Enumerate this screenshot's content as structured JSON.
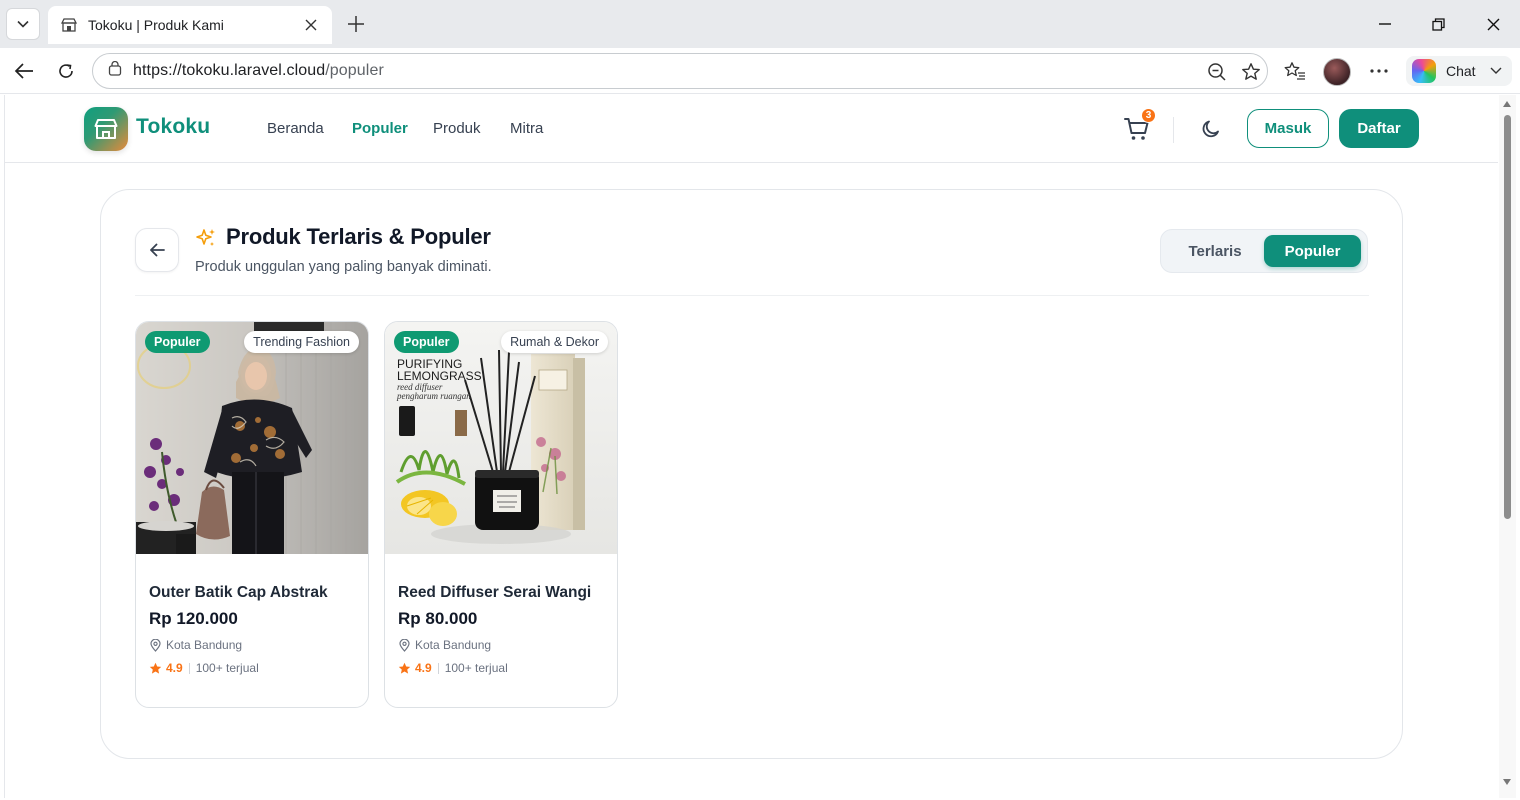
{
  "browser": {
    "tab_title": "Tokoku | Produk Kami",
    "url_host": "https://tokoku.laravel.cloud",
    "url_path": "/populer",
    "chat_label": "Chat"
  },
  "header": {
    "brand": "Tokoku",
    "nav": [
      {
        "label": "Beranda",
        "active": false
      },
      {
        "label": "Populer",
        "active": true
      },
      {
        "label": "Produk",
        "active": false
      },
      {
        "label": "Mitra",
        "active": false
      }
    ],
    "cart_count": "3",
    "login_label": "Masuk",
    "register_label": "Daftar"
  },
  "section": {
    "title": "Produk Terlaris & Populer",
    "subtitle": "Produk unggulan yang paling banyak diminati.",
    "tabs": [
      {
        "label": "Terlaris",
        "selected": false
      },
      {
        "label": "Populer",
        "selected": true
      }
    ]
  },
  "products": [
    {
      "badge": "Populer",
      "category": "Trending Fashion",
      "name": "Outer Batik Cap Abstrak",
      "price": "Rp 120.000",
      "location": "Kota Bandung",
      "rating": "4.9",
      "sold": "100+ terjual"
    },
    {
      "badge": "Populer",
      "category": "Rumah & Dekor",
      "name": "Reed Diffuser Serai Wangi",
      "price": "Rp 80.000",
      "location": "Kota Bandung",
      "rating": "4.9",
      "sold": "100+ terjual",
      "image_text": {
        "line1": "PURIFYING",
        "line2": "LEMONGRASS",
        "line3": "reed diffuser",
        "line4": "pengharum ruangan"
      }
    }
  ],
  "colors": {
    "brand": "#0f8f7b",
    "badge_green": "#0f9a72",
    "accent_orange": "#f97316",
    "text_dark": "#111827"
  }
}
